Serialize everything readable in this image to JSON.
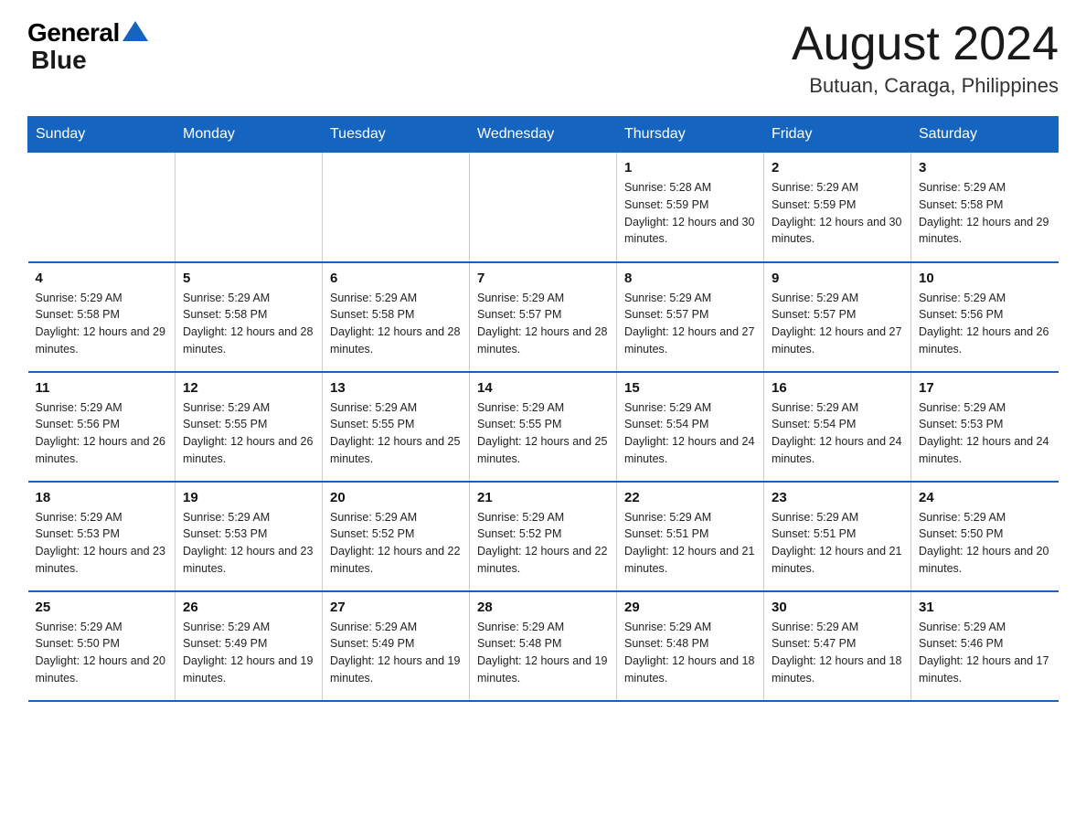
{
  "logo": {
    "general": "General",
    "blue": "Blue",
    "underline": "Blue"
  },
  "title": "August 2024",
  "subtitle": "Butuan, Caraga, Philippines",
  "days_of_week": [
    "Sunday",
    "Monday",
    "Tuesday",
    "Wednesday",
    "Thursday",
    "Friday",
    "Saturday"
  ],
  "weeks": [
    [
      {
        "day": "",
        "info": ""
      },
      {
        "day": "",
        "info": ""
      },
      {
        "day": "",
        "info": ""
      },
      {
        "day": "",
        "info": ""
      },
      {
        "day": "1",
        "info": "Sunrise: 5:28 AM\nSunset: 5:59 PM\nDaylight: 12 hours and 30 minutes."
      },
      {
        "day": "2",
        "info": "Sunrise: 5:29 AM\nSunset: 5:59 PM\nDaylight: 12 hours and 30 minutes."
      },
      {
        "day": "3",
        "info": "Sunrise: 5:29 AM\nSunset: 5:58 PM\nDaylight: 12 hours and 29 minutes."
      }
    ],
    [
      {
        "day": "4",
        "info": "Sunrise: 5:29 AM\nSunset: 5:58 PM\nDaylight: 12 hours and 29 minutes."
      },
      {
        "day": "5",
        "info": "Sunrise: 5:29 AM\nSunset: 5:58 PM\nDaylight: 12 hours and 28 minutes."
      },
      {
        "day": "6",
        "info": "Sunrise: 5:29 AM\nSunset: 5:58 PM\nDaylight: 12 hours and 28 minutes."
      },
      {
        "day": "7",
        "info": "Sunrise: 5:29 AM\nSunset: 5:57 PM\nDaylight: 12 hours and 28 minutes."
      },
      {
        "day": "8",
        "info": "Sunrise: 5:29 AM\nSunset: 5:57 PM\nDaylight: 12 hours and 27 minutes."
      },
      {
        "day": "9",
        "info": "Sunrise: 5:29 AM\nSunset: 5:57 PM\nDaylight: 12 hours and 27 minutes."
      },
      {
        "day": "10",
        "info": "Sunrise: 5:29 AM\nSunset: 5:56 PM\nDaylight: 12 hours and 26 minutes."
      }
    ],
    [
      {
        "day": "11",
        "info": "Sunrise: 5:29 AM\nSunset: 5:56 PM\nDaylight: 12 hours and 26 minutes."
      },
      {
        "day": "12",
        "info": "Sunrise: 5:29 AM\nSunset: 5:55 PM\nDaylight: 12 hours and 26 minutes."
      },
      {
        "day": "13",
        "info": "Sunrise: 5:29 AM\nSunset: 5:55 PM\nDaylight: 12 hours and 25 minutes."
      },
      {
        "day": "14",
        "info": "Sunrise: 5:29 AM\nSunset: 5:55 PM\nDaylight: 12 hours and 25 minutes."
      },
      {
        "day": "15",
        "info": "Sunrise: 5:29 AM\nSunset: 5:54 PM\nDaylight: 12 hours and 24 minutes."
      },
      {
        "day": "16",
        "info": "Sunrise: 5:29 AM\nSunset: 5:54 PM\nDaylight: 12 hours and 24 minutes."
      },
      {
        "day": "17",
        "info": "Sunrise: 5:29 AM\nSunset: 5:53 PM\nDaylight: 12 hours and 24 minutes."
      }
    ],
    [
      {
        "day": "18",
        "info": "Sunrise: 5:29 AM\nSunset: 5:53 PM\nDaylight: 12 hours and 23 minutes."
      },
      {
        "day": "19",
        "info": "Sunrise: 5:29 AM\nSunset: 5:53 PM\nDaylight: 12 hours and 23 minutes."
      },
      {
        "day": "20",
        "info": "Sunrise: 5:29 AM\nSunset: 5:52 PM\nDaylight: 12 hours and 22 minutes."
      },
      {
        "day": "21",
        "info": "Sunrise: 5:29 AM\nSunset: 5:52 PM\nDaylight: 12 hours and 22 minutes."
      },
      {
        "day": "22",
        "info": "Sunrise: 5:29 AM\nSunset: 5:51 PM\nDaylight: 12 hours and 21 minutes."
      },
      {
        "day": "23",
        "info": "Sunrise: 5:29 AM\nSunset: 5:51 PM\nDaylight: 12 hours and 21 minutes."
      },
      {
        "day": "24",
        "info": "Sunrise: 5:29 AM\nSunset: 5:50 PM\nDaylight: 12 hours and 20 minutes."
      }
    ],
    [
      {
        "day": "25",
        "info": "Sunrise: 5:29 AM\nSunset: 5:50 PM\nDaylight: 12 hours and 20 minutes."
      },
      {
        "day": "26",
        "info": "Sunrise: 5:29 AM\nSunset: 5:49 PM\nDaylight: 12 hours and 19 minutes."
      },
      {
        "day": "27",
        "info": "Sunrise: 5:29 AM\nSunset: 5:49 PM\nDaylight: 12 hours and 19 minutes."
      },
      {
        "day": "28",
        "info": "Sunrise: 5:29 AM\nSunset: 5:48 PM\nDaylight: 12 hours and 19 minutes."
      },
      {
        "day": "29",
        "info": "Sunrise: 5:29 AM\nSunset: 5:48 PM\nDaylight: 12 hours and 18 minutes."
      },
      {
        "day": "30",
        "info": "Sunrise: 5:29 AM\nSunset: 5:47 PM\nDaylight: 12 hours and 18 minutes."
      },
      {
        "day": "31",
        "info": "Sunrise: 5:29 AM\nSunset: 5:46 PM\nDaylight: 12 hours and 17 minutes."
      }
    ]
  ]
}
